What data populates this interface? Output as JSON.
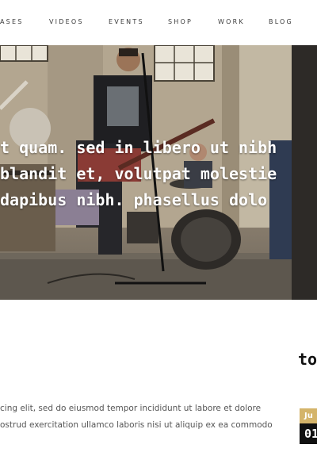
{
  "nav": {
    "items": [
      "ASES",
      "VIDEOS",
      "EVENTS",
      "SHOP",
      "WORK",
      "BLOG"
    ]
  },
  "hero": {
    "lines": [
      "t quam. sed in libero ut nibh",
      " blandit et, volutpat molestie",
      " dapibus nibh. phasellus dolo"
    ]
  },
  "section": {
    "title": "to"
  },
  "body": {
    "lines": [
      "cing elit, sed do eiusmod tempor incididunt ut labore et dolore",
      "ostrud exercitation ullamco laboris nisi ut aliquip ex ea commodo"
    ]
  },
  "event_date": {
    "month": "Ju",
    "day": "01"
  },
  "colors": {
    "accent": "#d4b46a",
    "dark": "#111111"
  }
}
